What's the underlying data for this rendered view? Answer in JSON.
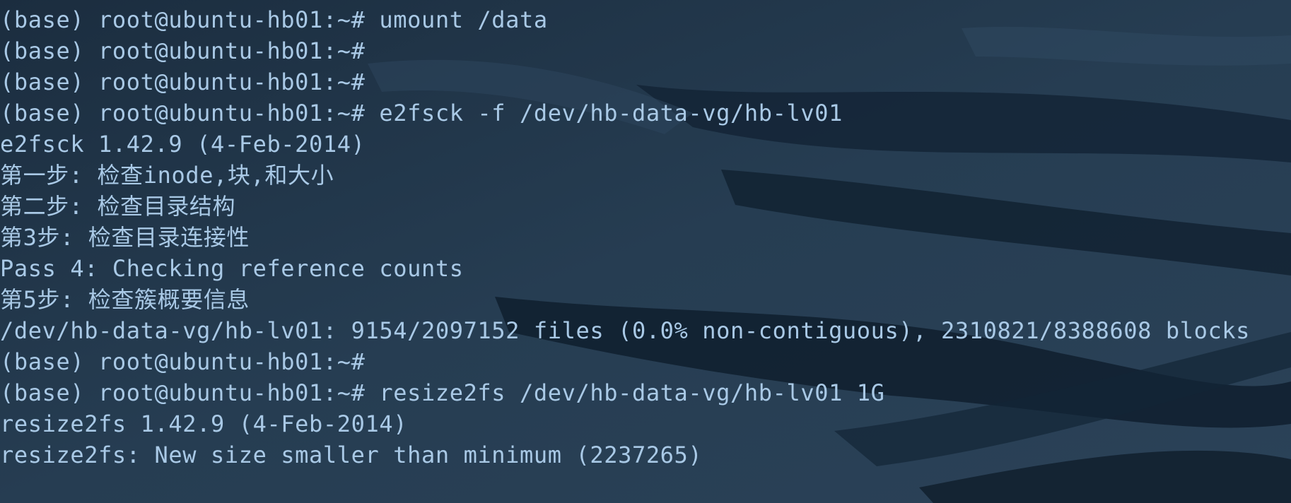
{
  "terminal": {
    "background_color": "#1f3447",
    "text_color": "#a9c9e6",
    "lines": [
      "(base) root@ubuntu-hb01:~# umount /data",
      "(base) root@ubuntu-hb01:~#",
      "(base) root@ubuntu-hb01:~#",
      "(base) root@ubuntu-hb01:~# e2fsck -f /dev/hb-data-vg/hb-lv01",
      "e2fsck 1.42.9 (4-Feb-2014)",
      "第一步: 检查inode,块,和大小",
      "第二步: 检查目录结构",
      "第3步: 检查目录连接性",
      "Pass 4: Checking reference counts",
      "第5步: 检查簇概要信息",
      "/dev/hb-data-vg/hb-lv01: 9154/2097152 files (0.0% non-contiguous), 2310821/8388608 blocks",
      "(base) root@ubuntu-hb01:~#",
      "(base) root@ubuntu-hb01:~# resize2fs /dev/hb-data-vg/hb-lv01 1G",
      "resize2fs 1.42.9 (4-Feb-2014)",
      "resize2fs: New size smaller than minimum (2237265)"
    ]
  }
}
